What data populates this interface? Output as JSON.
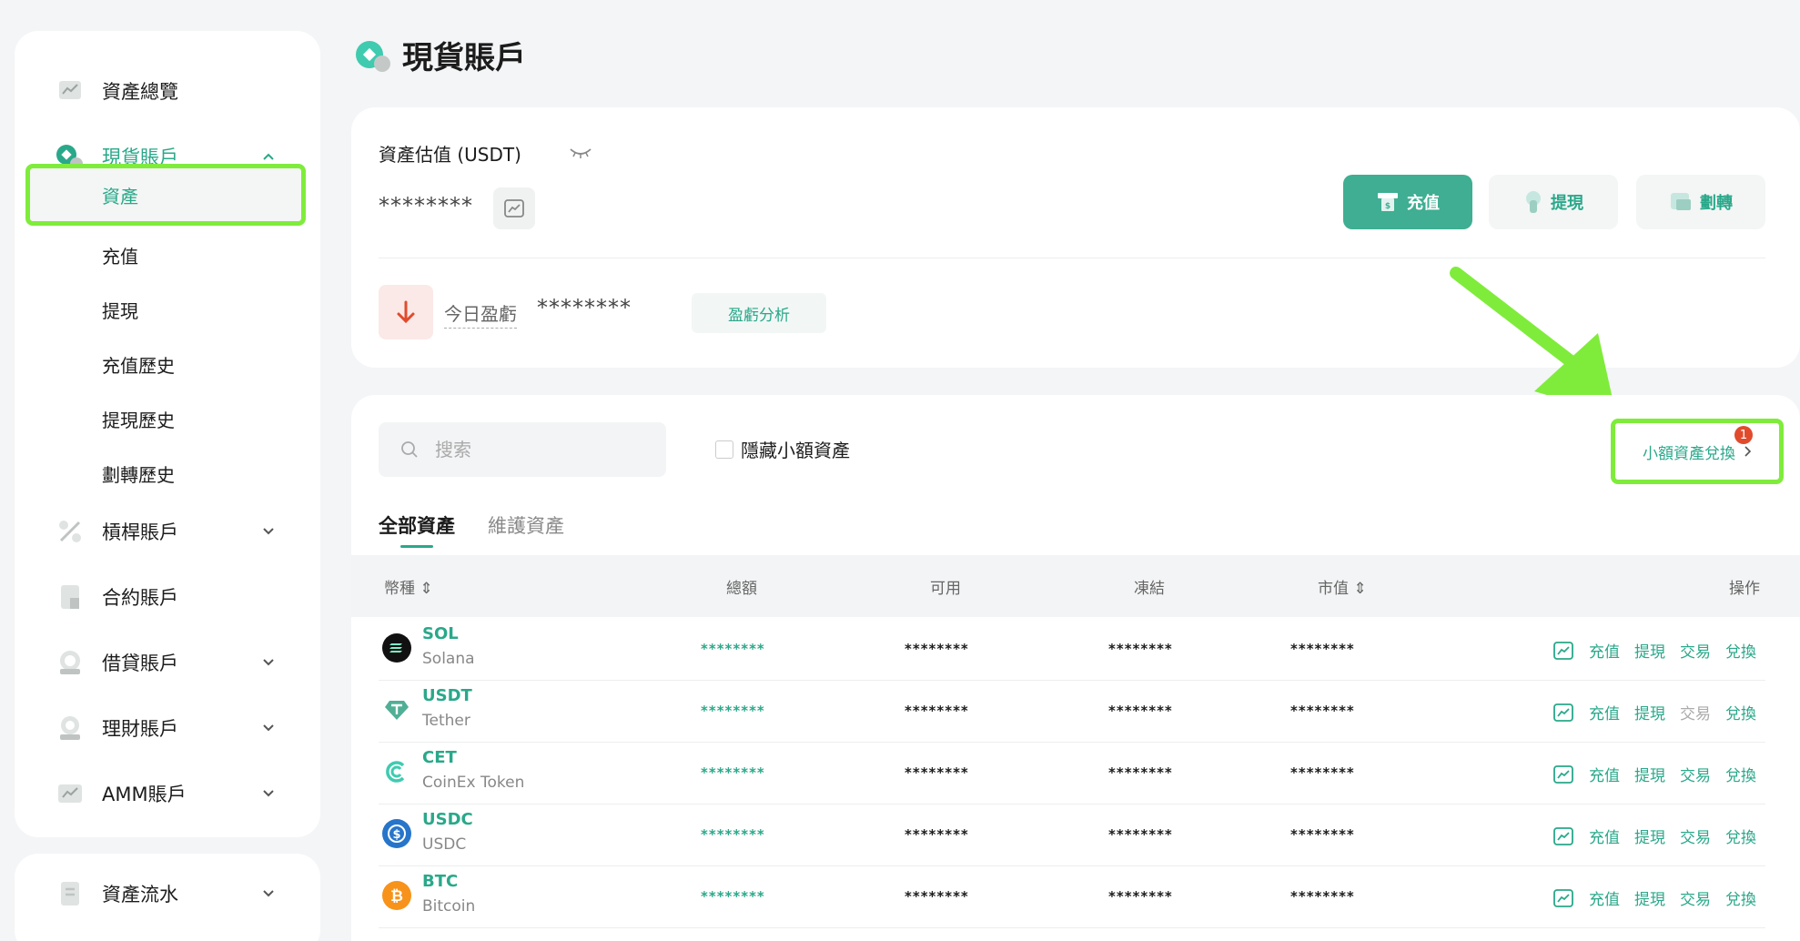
{
  "sidebar": {
    "items": [
      {
        "label": "資產總覽",
        "icon": "chart-card-icon"
      },
      {
        "label": "現貨賬戶",
        "icon": "spot-icon",
        "active": true,
        "expanded": true
      },
      {
        "label": "槓桿賬戶",
        "icon": "percent-icon"
      },
      {
        "label": "合約賬戶",
        "icon": "contract-icon"
      },
      {
        "label": "借貸賬戶",
        "icon": "loan-icon"
      },
      {
        "label": "理財賬戶",
        "icon": "finance-icon"
      },
      {
        "label": "AMM賬戶",
        "icon": "amm-icon"
      }
    ],
    "sub_items": [
      "資產",
      "充值",
      "提現",
      "充值歷史",
      "提現歷史",
      "劃轉歷史"
    ],
    "bottom": {
      "label": "資產流水",
      "icon": "ledger-icon"
    }
  },
  "header": {
    "title": "現貨賬戶"
  },
  "summary": {
    "est_label": "資產估值 (USDT)",
    "est_value": "********",
    "pnl_label": "今日盈虧",
    "pnl_value": "********",
    "pnl_button": "盈虧分析",
    "actions": [
      "充值",
      "提現",
      "劃轉"
    ]
  },
  "assets": {
    "search_placeholder": "搜索",
    "hide_small": "隱藏小額資產",
    "small_convert": "小額資產兌換",
    "badge_count": "1",
    "tabs": [
      "全部資產",
      "維護資產"
    ],
    "columns": [
      "幣種",
      "總額",
      "可用",
      "凍結",
      "市值",
      "操作"
    ],
    "rows": [
      {
        "symbol": "SOL",
        "name": "Solana",
        "total": "********",
        "available": "********",
        "frozen": "********",
        "market": "********"
      },
      {
        "symbol": "USDT",
        "name": "Tether",
        "total": "********",
        "available": "********",
        "frozen": "********",
        "market": "********"
      },
      {
        "symbol": "CET",
        "name": "CoinEx Token",
        "total": "********",
        "available": "********",
        "frozen": "********",
        "market": "********"
      },
      {
        "symbol": "USDC",
        "name": "USDC",
        "total": "********",
        "available": "********",
        "frozen": "********",
        "market": "********"
      },
      {
        "symbol": "BTC",
        "name": "Bitcoin",
        "total": "********",
        "available": "********",
        "frozen": "********",
        "market": "********"
      }
    ],
    "ops": [
      "充值",
      "提現",
      "交易",
      "兌換"
    ]
  },
  "colors": {
    "accent": "#2aa88a",
    "highlight": "#7fec3b",
    "primary_button": "#3fae92"
  }
}
